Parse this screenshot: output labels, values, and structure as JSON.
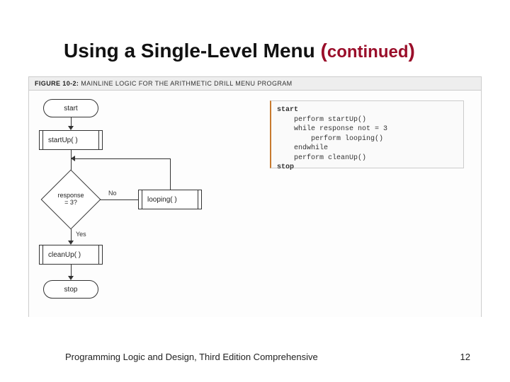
{
  "title": {
    "main": "Using a Single-Level Menu ",
    "paren_open": "(",
    "continued": "continued",
    "paren_close": ")"
  },
  "figure": {
    "label": "FIGURE 10-2:",
    "caption": "MAINLINE LOGIC FOR THE ARITHMETIC DRILL MENU PROGRAM"
  },
  "flowchart": {
    "start": "start",
    "startup": "startUp( )",
    "decision": "response\n= 3?",
    "no": "No",
    "yes": "Yes",
    "looping": "looping( )",
    "cleanup": "cleanUp( )",
    "stop": "stop"
  },
  "pseudocode": {
    "l1": "start",
    "l2": "    perform startUp()",
    "l3": "    while response not = 3",
    "l4": "        perform looping()",
    "l5": "    endwhile",
    "l6": "    perform cleanUp()",
    "l7": "stop"
  },
  "footer": {
    "text": "Programming Logic and Design, Third Edition Comprehensive",
    "page": "12"
  }
}
